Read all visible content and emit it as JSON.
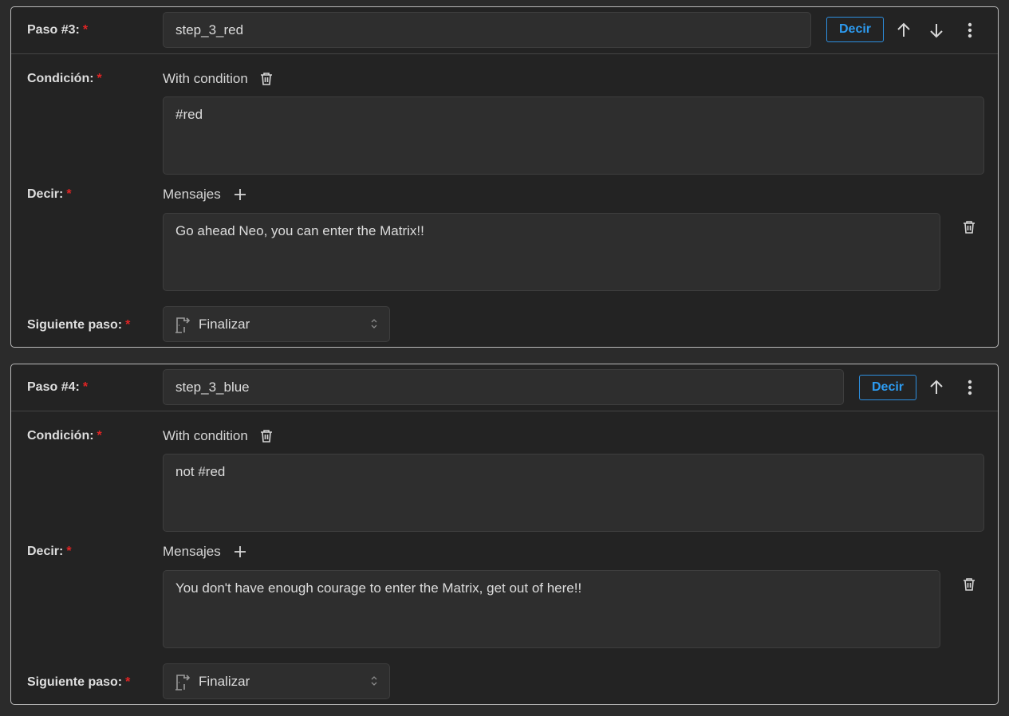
{
  "steps": [
    {
      "label": "Paso #3:",
      "name_value": "step_3_red",
      "type_button": "Decir",
      "has_up": true,
      "has_down": true,
      "condition_label": "Condición:",
      "condition_mode": "With condition",
      "condition_value": "#red",
      "say_label": "Decir:",
      "messages_label": "Mensajes",
      "message_value": "Go ahead Neo, you can enter the Matrix!!",
      "next_label": "Siguiente paso:",
      "next_value": "Finalizar"
    },
    {
      "label": "Paso #4:",
      "name_value": "step_3_blue",
      "type_button": "Decir",
      "has_up": true,
      "has_down": false,
      "condition_label": "Condición:",
      "condition_mode": "With condition",
      "condition_value": "not #red",
      "say_label": "Decir:",
      "messages_label": "Mensajes",
      "message_value": "You don't have enough courage to enter the Matrix, get out of here!!",
      "next_label": "Siguiente paso:",
      "next_value": "Finalizar"
    }
  ],
  "required_marker": "*",
  "colors": {
    "accent": "#2d9bf0",
    "required": "#e02424",
    "background": "#2b2b2b",
    "card": "#232323"
  }
}
